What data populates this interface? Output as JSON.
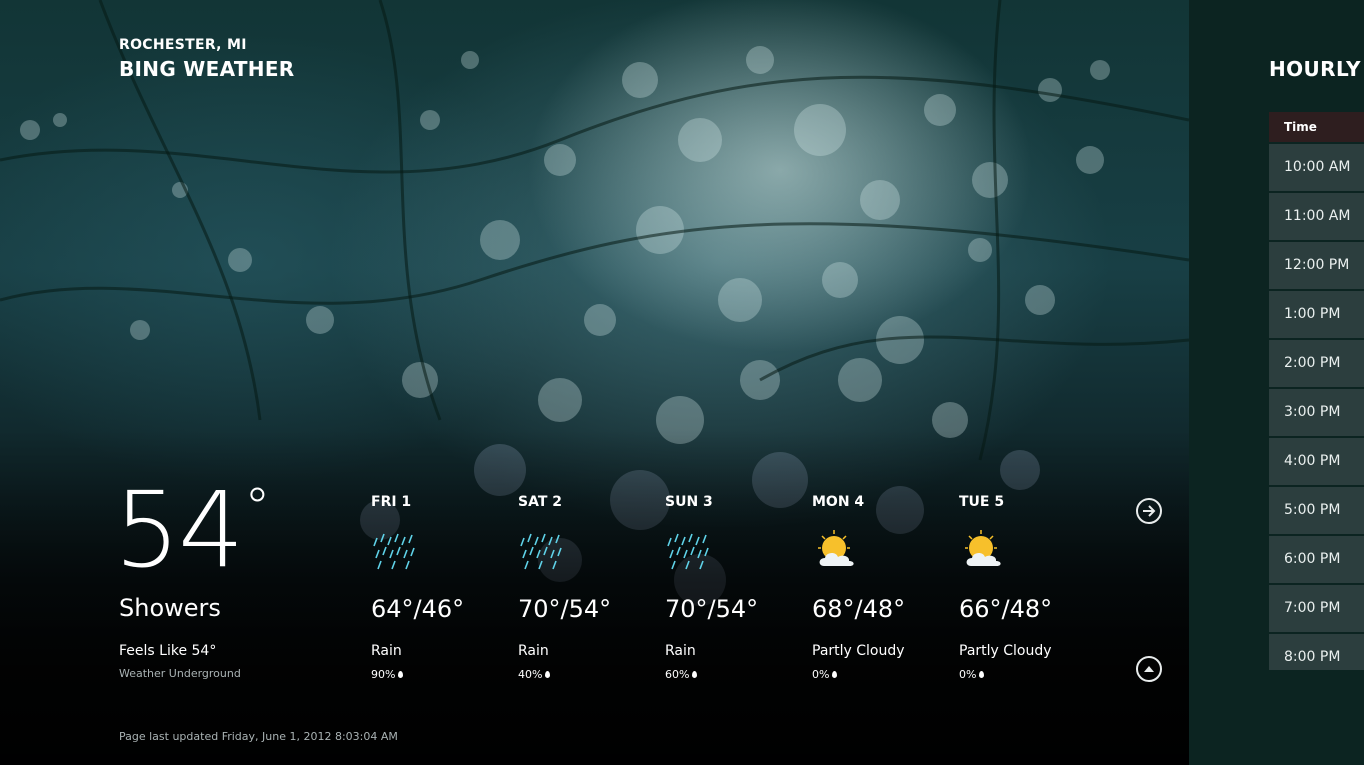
{
  "header": {
    "location": "ROCHESTER, MI",
    "app_title": "BING WEATHER"
  },
  "current": {
    "temperature": "54",
    "degree": "°",
    "condition": "Showers",
    "feels_like": "Feels Like 54°",
    "provider": "Weather Underground"
  },
  "forecast": [
    {
      "day": "FRI 1",
      "icon": "rain-icon",
      "temps": "64°/46°",
      "condition": "Rain",
      "precip": "90%"
    },
    {
      "day": "SAT 2",
      "icon": "rain-icon",
      "temps": "70°/54°",
      "condition": "Rain",
      "precip": "40%"
    },
    {
      "day": "SUN 3",
      "icon": "rain-icon",
      "temps": "70°/54°",
      "condition": "Rain",
      "precip": "60%"
    },
    {
      "day": "MON 4",
      "icon": "partly-cloudy-icon",
      "temps": "68°/48°",
      "condition": "Partly Cloudy",
      "precip": "0%"
    },
    {
      "day": "TUE 5",
      "icon": "partly-cloudy-icon",
      "temps": "66°/48°",
      "condition": "Partly Cloudy",
      "precip": "0%"
    }
  ],
  "updated": "Page last updated Friday, June 1, 2012 8:03:04 AM",
  "hourly": {
    "title": "HOURLY",
    "column_header": "Time",
    "times": [
      "10:00 AM",
      "11:00 AM",
      "12:00 PM",
      "1:00 PM",
      "2:00 PM",
      "3:00 PM",
      "4:00 PM",
      "5:00 PM",
      "6:00 PM",
      "7:00 PM",
      "8:00 PM"
    ]
  },
  "colors": {
    "right_panel": "#0c2421",
    "hourly_row": "#2c3e3e",
    "time_header": "#2e1e1f"
  }
}
